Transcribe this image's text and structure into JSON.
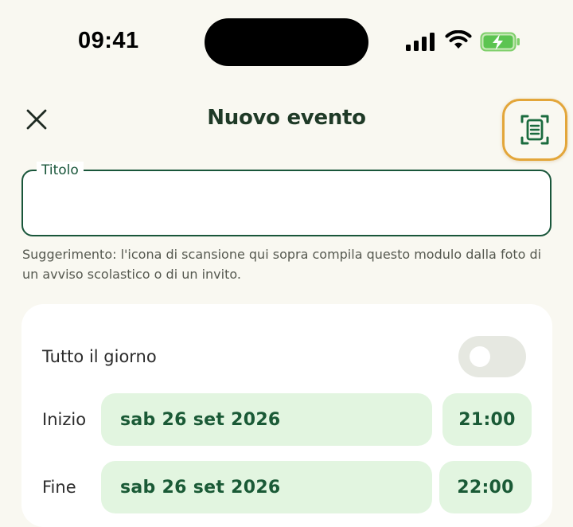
{
  "status": {
    "time": "09:41"
  },
  "header": {
    "title": "Nuovo evento"
  },
  "form": {
    "title_label": "Titolo",
    "title_value": "",
    "hint": "Suggerimento: l'icona di scansione qui sopra compila questo modulo dalla foto di un avviso scolastico o di un invito."
  },
  "card": {
    "allday_label": "Tutto il giorno",
    "allday_on": false,
    "start_label": "Inizio",
    "start_date": "sab 26 set 2026",
    "start_time": "21:00",
    "end_label": "Fine",
    "end_date": "sab 26 set 2026",
    "end_time": "22:00"
  },
  "colors": {
    "accent": "#19563a",
    "highlight": "#e3a63a",
    "pill": "#e2f5e0",
    "background": "#f9f8f1"
  }
}
